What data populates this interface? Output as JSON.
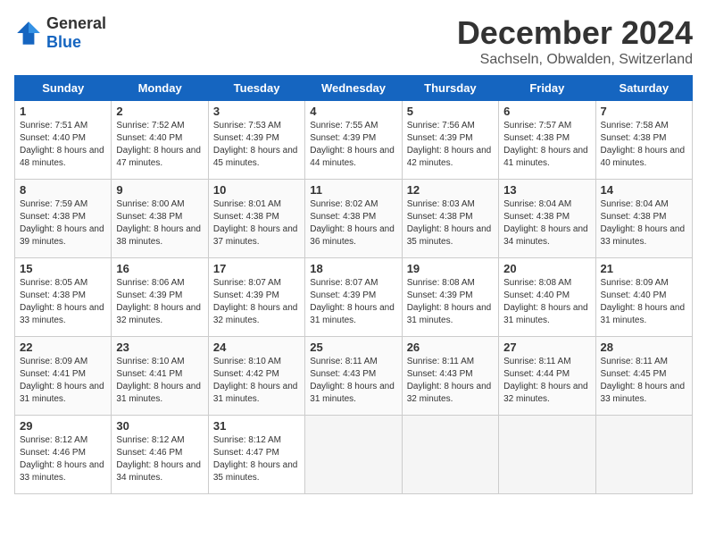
{
  "header": {
    "logo_general": "General",
    "logo_blue": "Blue",
    "title": "December 2024",
    "location": "Sachseln, Obwalden, Switzerland"
  },
  "days_of_week": [
    "Sunday",
    "Monday",
    "Tuesday",
    "Wednesday",
    "Thursday",
    "Friday",
    "Saturday"
  ],
  "weeks": [
    [
      {
        "day": "1",
        "sunrise": "7:51 AM",
        "sunset": "4:40 PM",
        "daylight": "8 hours and 48 minutes."
      },
      {
        "day": "2",
        "sunrise": "7:52 AM",
        "sunset": "4:40 PM",
        "daylight": "8 hours and 47 minutes."
      },
      {
        "day": "3",
        "sunrise": "7:53 AM",
        "sunset": "4:39 PM",
        "daylight": "8 hours and 45 minutes."
      },
      {
        "day": "4",
        "sunrise": "7:55 AM",
        "sunset": "4:39 PM",
        "daylight": "8 hours and 44 minutes."
      },
      {
        "day": "5",
        "sunrise": "7:56 AM",
        "sunset": "4:39 PM",
        "daylight": "8 hours and 42 minutes."
      },
      {
        "day": "6",
        "sunrise": "7:57 AM",
        "sunset": "4:38 PM",
        "daylight": "8 hours and 41 minutes."
      },
      {
        "day": "7",
        "sunrise": "7:58 AM",
        "sunset": "4:38 PM",
        "daylight": "8 hours and 40 minutes."
      }
    ],
    [
      {
        "day": "8",
        "sunrise": "7:59 AM",
        "sunset": "4:38 PM",
        "daylight": "8 hours and 39 minutes."
      },
      {
        "day": "9",
        "sunrise": "8:00 AM",
        "sunset": "4:38 PM",
        "daylight": "8 hours and 38 minutes."
      },
      {
        "day": "10",
        "sunrise": "8:01 AM",
        "sunset": "4:38 PM",
        "daylight": "8 hours and 37 minutes."
      },
      {
        "day": "11",
        "sunrise": "8:02 AM",
        "sunset": "4:38 PM",
        "daylight": "8 hours and 36 minutes."
      },
      {
        "day": "12",
        "sunrise": "8:03 AM",
        "sunset": "4:38 PM",
        "daylight": "8 hours and 35 minutes."
      },
      {
        "day": "13",
        "sunrise": "8:04 AM",
        "sunset": "4:38 PM",
        "daylight": "8 hours and 34 minutes."
      },
      {
        "day": "14",
        "sunrise": "8:04 AM",
        "sunset": "4:38 PM",
        "daylight": "8 hours and 33 minutes."
      }
    ],
    [
      {
        "day": "15",
        "sunrise": "8:05 AM",
        "sunset": "4:38 PM",
        "daylight": "8 hours and 33 minutes."
      },
      {
        "day": "16",
        "sunrise": "8:06 AM",
        "sunset": "4:39 PM",
        "daylight": "8 hours and 32 minutes."
      },
      {
        "day": "17",
        "sunrise": "8:07 AM",
        "sunset": "4:39 PM",
        "daylight": "8 hours and 32 minutes."
      },
      {
        "day": "18",
        "sunrise": "8:07 AM",
        "sunset": "4:39 PM",
        "daylight": "8 hours and 31 minutes."
      },
      {
        "day": "19",
        "sunrise": "8:08 AM",
        "sunset": "4:39 PM",
        "daylight": "8 hours and 31 minutes."
      },
      {
        "day": "20",
        "sunrise": "8:08 AM",
        "sunset": "4:40 PM",
        "daylight": "8 hours and 31 minutes."
      },
      {
        "day": "21",
        "sunrise": "8:09 AM",
        "sunset": "4:40 PM",
        "daylight": "8 hours and 31 minutes."
      }
    ],
    [
      {
        "day": "22",
        "sunrise": "8:09 AM",
        "sunset": "4:41 PM",
        "daylight": "8 hours and 31 minutes."
      },
      {
        "day": "23",
        "sunrise": "8:10 AM",
        "sunset": "4:41 PM",
        "daylight": "8 hours and 31 minutes."
      },
      {
        "day": "24",
        "sunrise": "8:10 AM",
        "sunset": "4:42 PM",
        "daylight": "8 hours and 31 minutes."
      },
      {
        "day": "25",
        "sunrise": "8:11 AM",
        "sunset": "4:43 PM",
        "daylight": "8 hours and 31 minutes."
      },
      {
        "day": "26",
        "sunrise": "8:11 AM",
        "sunset": "4:43 PM",
        "daylight": "8 hours and 32 minutes."
      },
      {
        "day": "27",
        "sunrise": "8:11 AM",
        "sunset": "4:44 PM",
        "daylight": "8 hours and 32 minutes."
      },
      {
        "day": "28",
        "sunrise": "8:11 AM",
        "sunset": "4:45 PM",
        "daylight": "8 hours and 33 minutes."
      }
    ],
    [
      {
        "day": "29",
        "sunrise": "8:12 AM",
        "sunset": "4:46 PM",
        "daylight": "8 hours and 33 minutes."
      },
      {
        "day": "30",
        "sunrise": "8:12 AM",
        "sunset": "4:46 PM",
        "daylight": "8 hours and 34 minutes."
      },
      {
        "day": "31",
        "sunrise": "8:12 AM",
        "sunset": "4:47 PM",
        "daylight": "8 hours and 35 minutes."
      },
      null,
      null,
      null,
      null
    ]
  ]
}
